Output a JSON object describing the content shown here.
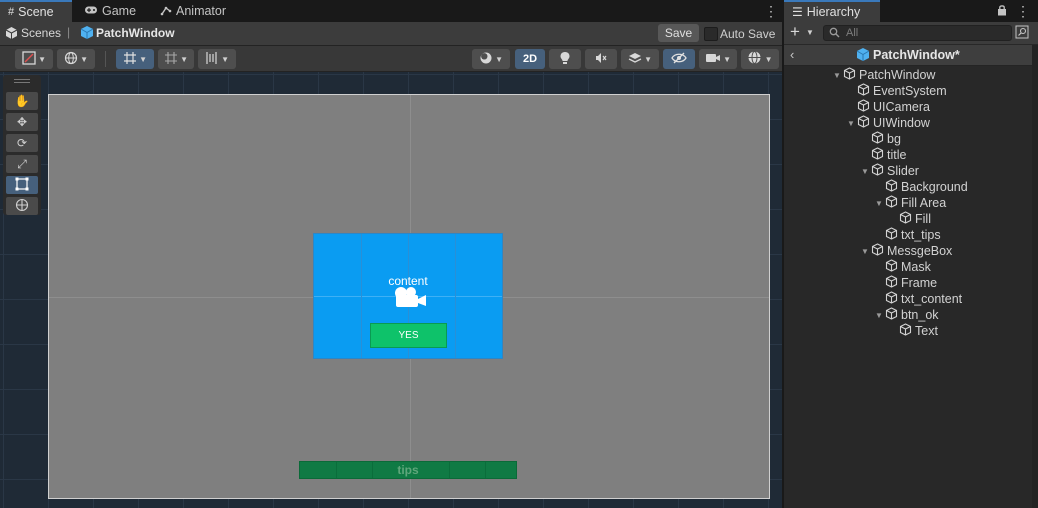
{
  "scene_tabs": {
    "scene": "Scene",
    "game": "Game",
    "animator": "Animator"
  },
  "breadcrumb": {
    "scenes": "Scenes",
    "separator": "|",
    "current": "PatchWindow"
  },
  "toolbar": {
    "save": "Save",
    "auto_save": "Auto Save",
    "mode_2d": "2D"
  },
  "canvas": {
    "content_label": "content",
    "yes_label": "YES",
    "tips_label": "tips"
  },
  "hierarchy": {
    "tab": "Hierarchy",
    "add": "+",
    "search_placeholder": "All",
    "scene_title": "PatchWindow*",
    "items": [
      {
        "label": "PatchWindow",
        "expanded": true
      },
      {
        "label": "EventSystem"
      },
      {
        "label": "UICamera"
      },
      {
        "label": "UIWindow",
        "expanded": true
      },
      {
        "label": "bg"
      },
      {
        "label": "title"
      },
      {
        "label": "Slider",
        "expanded": true
      },
      {
        "label": "Background"
      },
      {
        "label": "Fill Area",
        "expanded": true
      },
      {
        "label": "Fill"
      },
      {
        "label": "txt_tips"
      },
      {
        "label": "MessgeBox",
        "expanded": true
      },
      {
        "label": "Mask"
      },
      {
        "label": "Frame"
      },
      {
        "label": "txt_content"
      },
      {
        "label": "btn_ok",
        "expanded": true
      },
      {
        "label": "Text"
      }
    ]
  },
  "colors": {
    "accent": "#3a79bb",
    "canvas_gray": "#7f7f7f",
    "msgbox_blue": "#0a9cf2",
    "yes_green": "#0ec26a",
    "tips_green": "#0f7a44"
  }
}
